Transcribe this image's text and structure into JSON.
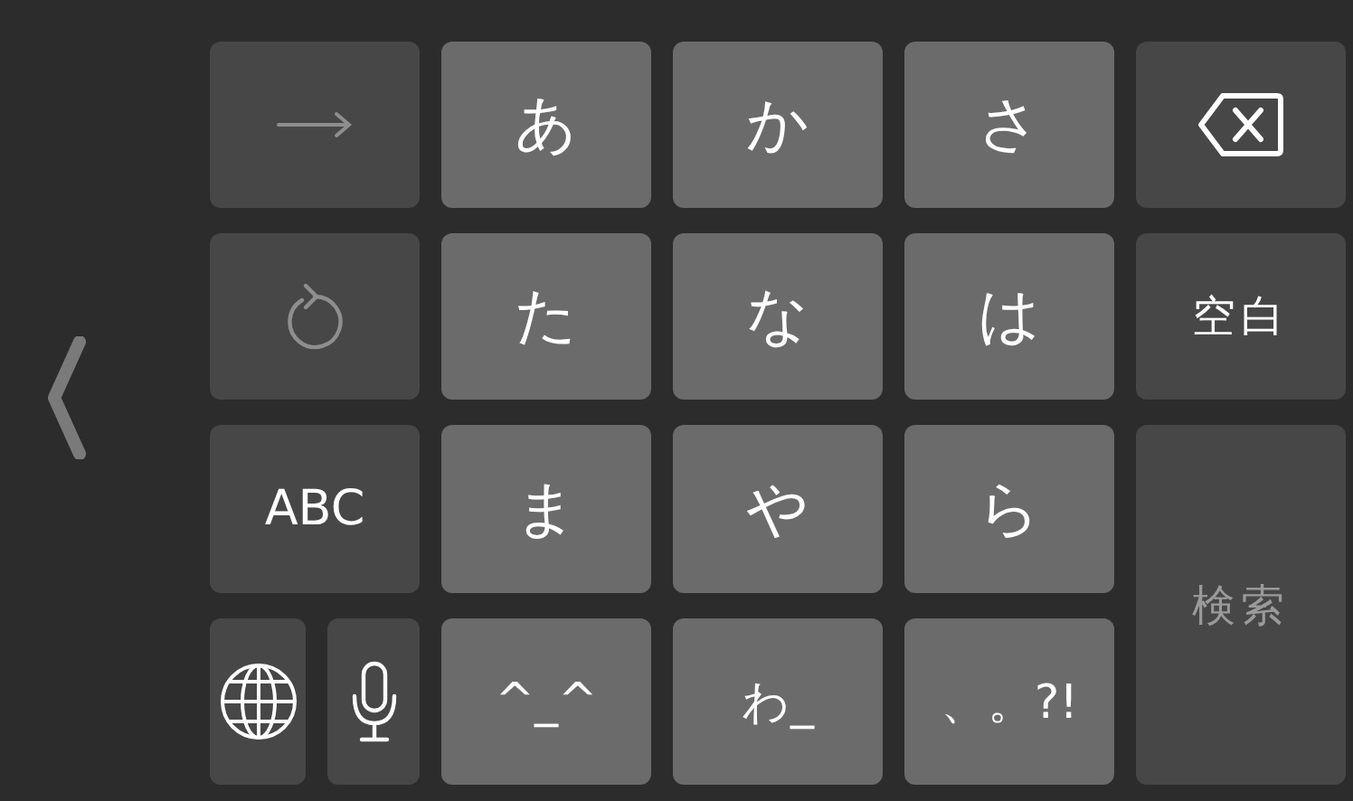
{
  "keys": [
    {
      "kind": "next",
      "disabled": true
    },
    {
      "kind": "kana",
      "label": "あ"
    },
    {
      "kind": "kana",
      "label": "か"
    },
    {
      "kind": "kana",
      "label": "さ"
    },
    {
      "kind": "backspace",
      "disabled": false
    },
    {
      "kind": "undo",
      "disabled": true
    },
    {
      "kind": "kana",
      "label": "た"
    },
    {
      "kind": "kana",
      "label": "な"
    },
    {
      "kind": "kana",
      "label": "は"
    },
    {
      "kind": "space",
      "label": "空白",
      "disabled": false
    },
    {
      "kind": "abc",
      "label": "ABC",
      "disabled": false
    },
    {
      "kind": "kana",
      "label": "ま"
    },
    {
      "kind": "kana",
      "label": "や"
    },
    {
      "kind": "kana",
      "label": "ら"
    },
    {
      "kind": "search",
      "label": "検索",
      "disabled": true
    },
    {
      "kind": "globe",
      "disabled": false
    },
    {
      "kind": "mic",
      "disabled": false
    },
    {
      "kind": "kana",
      "label": "^_^"
    },
    {
      "kind": "kana",
      "label": "わ_"
    },
    {
      "kind": "kana",
      "label": "、。?!"
    }
  ]
}
